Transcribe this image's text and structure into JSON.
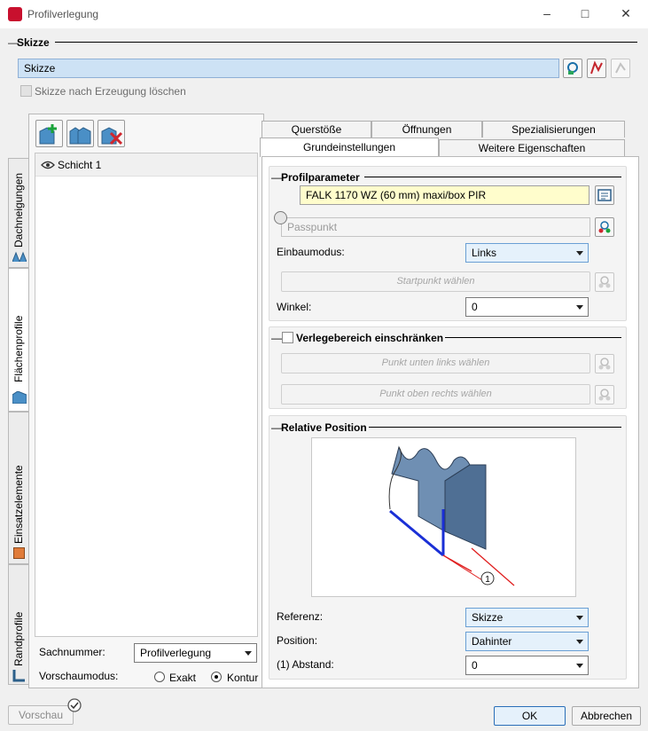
{
  "window": {
    "title": "Profilverlegung"
  },
  "skizze_section": {
    "header": "Skizze",
    "field_value": "Skizze",
    "delete_checkbox_label": "Skizze nach Erzeugung löschen"
  },
  "vertical_tabs": [
    "Dachneigungen",
    "Flächenprofile",
    "Einsatzelemente",
    "Randprofile"
  ],
  "layers": [
    {
      "label": "Schicht 1"
    }
  ],
  "left_bottom": {
    "sachnummer_label": "Sachnummer:",
    "sachnummer_value": "Profilverlegung",
    "vorschaumodus_label": "Vorschaumodus:",
    "radio_exakt": "Exakt",
    "radio_kontur": "Kontur"
  },
  "tabs": {
    "row1": [
      "Querstöße",
      "Öffnungen",
      "Spezialisierungen"
    ],
    "row2": [
      "Grundeinstellungen",
      "Weitere Eigenschaften"
    ]
  },
  "profilparameter": {
    "header": "Profilparameter",
    "profile_value": "FALK 1170 WZ (60 mm) maxi/box PIR",
    "passpunkt_placeholder": "Passpunkt",
    "einbaumodus_label": "Einbaumodus:",
    "einbaumodus_value": "Links",
    "startpunkt_button": "Startpunkt wählen",
    "winkel_label": "Winkel:",
    "winkel_value": "0"
  },
  "verlegebereich": {
    "header": "Verlegebereich einschränken",
    "button_links": "Punkt unten links wählen",
    "button_rechts": "Punkt oben rechts wählen"
  },
  "relative_position": {
    "header": "Relative Position",
    "diagram_marker": "1",
    "referenz_label": "Referenz:",
    "referenz_value": "Skizze",
    "position_label": "Position:",
    "position_value": "Dahinter",
    "abstand_label": "(1) Abstand:",
    "abstand_value": "0"
  },
  "footer": {
    "preview": "Vorschau",
    "ok": "OK",
    "cancel": "Abbrechen"
  },
  "colors": {
    "accent": "#cde2f5",
    "profile_field": "#fffdcc",
    "diagram_line_blue": "#1a2fd6",
    "diagram_line_red": "#e01e1e"
  }
}
